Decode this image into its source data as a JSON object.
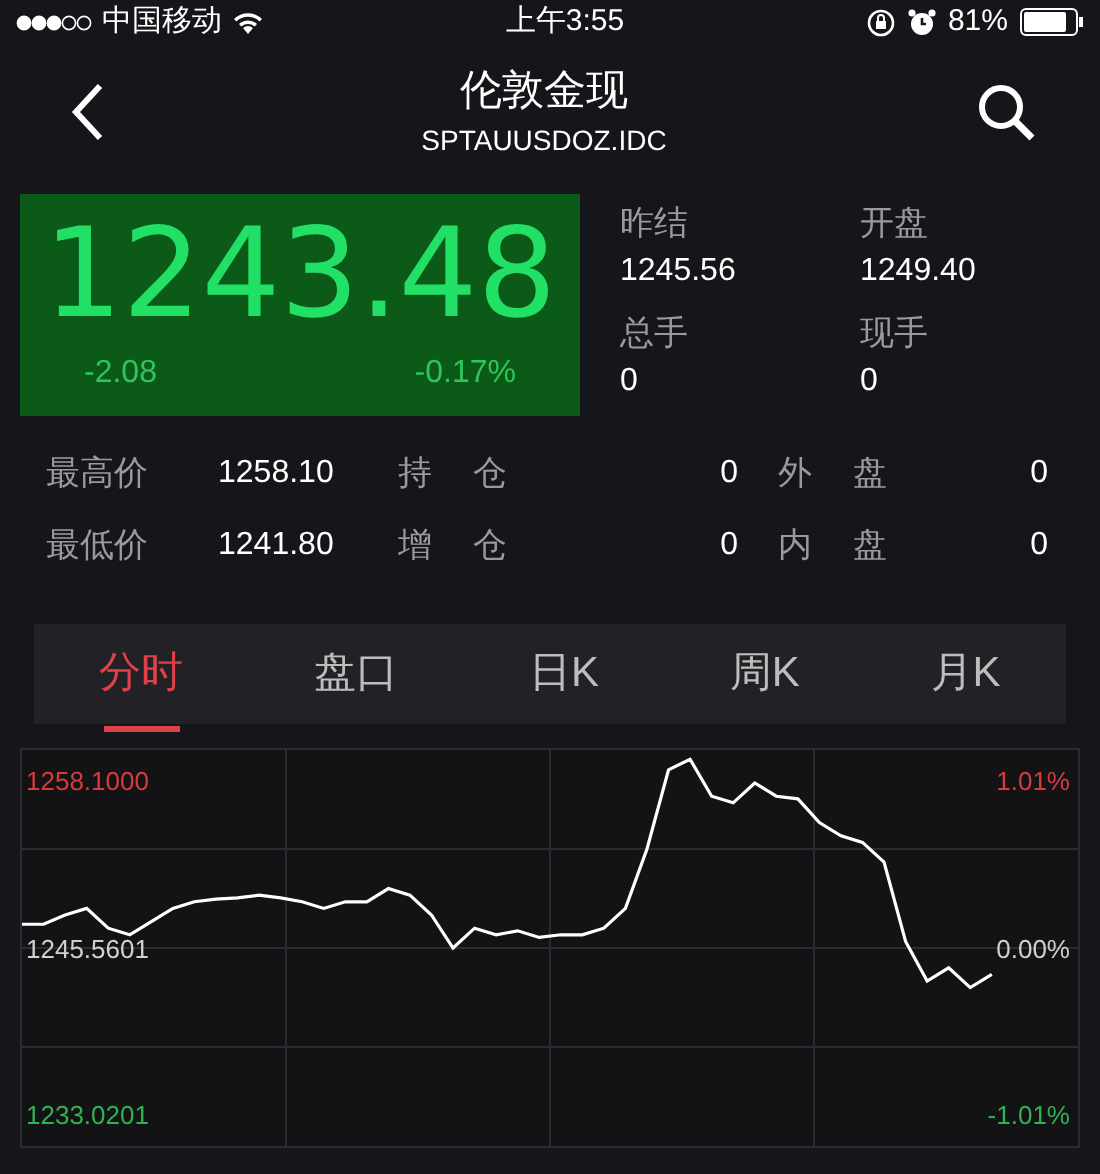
{
  "status_bar": {
    "carrier": "中国移动",
    "time": "上午3:55",
    "battery": "81%"
  },
  "header": {
    "title": "伦敦金现",
    "subtitle": "SPTAUUSDOZ.IDC"
  },
  "quote": {
    "price": "1243.48",
    "change": "-2.08",
    "change_pct": "-0.17%"
  },
  "summary": [
    {
      "label": "昨结",
      "value": "1245.56"
    },
    {
      "label": "开盘",
      "value": "1249.40"
    },
    {
      "label": "总手",
      "value": "0"
    },
    {
      "label": "现手",
      "value": "0"
    }
  ],
  "stats": [
    [
      {
        "label": "最高价",
        "value": "1258.10"
      },
      {
        "label": "持仓",
        "value": "0"
      },
      {
        "label": "外盘",
        "value": "0"
      }
    ],
    [
      {
        "label": "最低价",
        "value": "1241.80"
      },
      {
        "label": "增仓",
        "value": "0"
      },
      {
        "label": "内盘",
        "value": "0"
      }
    ]
  ],
  "tabs": [
    {
      "label": "分时",
      "selected": true
    },
    {
      "label": "盘口",
      "selected": false
    },
    {
      "label": "日K",
      "selected": false
    },
    {
      "label": "周K",
      "selected": false
    },
    {
      "label": "月K",
      "selected": false
    }
  ],
  "chart": {
    "percent_labels": [
      {
        "label": "1.01%",
        "kind": "up"
      },
      {
        "label": "0.00%",
        "kind": "flat"
      },
      {
        "label": "-1.01%",
        "kind": "down"
      }
    ],
    "chart_data": {
      "type": "line",
      "ylim": [
        1230.5,
        1260.5
      ],
      "yticks": [
        {
          "value": 1258.1,
          "label": "1258.1000"
        },
        {
          "value": 1245.5601,
          "label": "1245.5601"
        },
        {
          "value": 1233.0201,
          "label": "1233.0201"
        }
      ],
      "series": [
        {
          "color": "#ffffff",
          "values": [
            1247.3,
            1247.3,
            1248,
            1248.5,
            1247,
            1246.5,
            1247.5,
            1248.5,
            1249,
            1249.2,
            1249.3,
            1249.5,
            1249.3,
            1249,
            1248.5,
            1249,
            1249,
            1250,
            1249.5,
            1248,
            1245.5,
            1247,
            1246.5,
            1246.8,
            1246.3,
            1246.5,
            1246.5,
            1247,
            1248.5,
            1253,
            1259,
            1259.8,
            1257,
            1256.5,
            1258,
            1257,
            1256.8,
            1255,
            1254,
            1253.5,
            1252,
            1246,
            1243,
            1244,
            1242.5,
            1243.5
          ]
        }
      ]
    }
  }
}
